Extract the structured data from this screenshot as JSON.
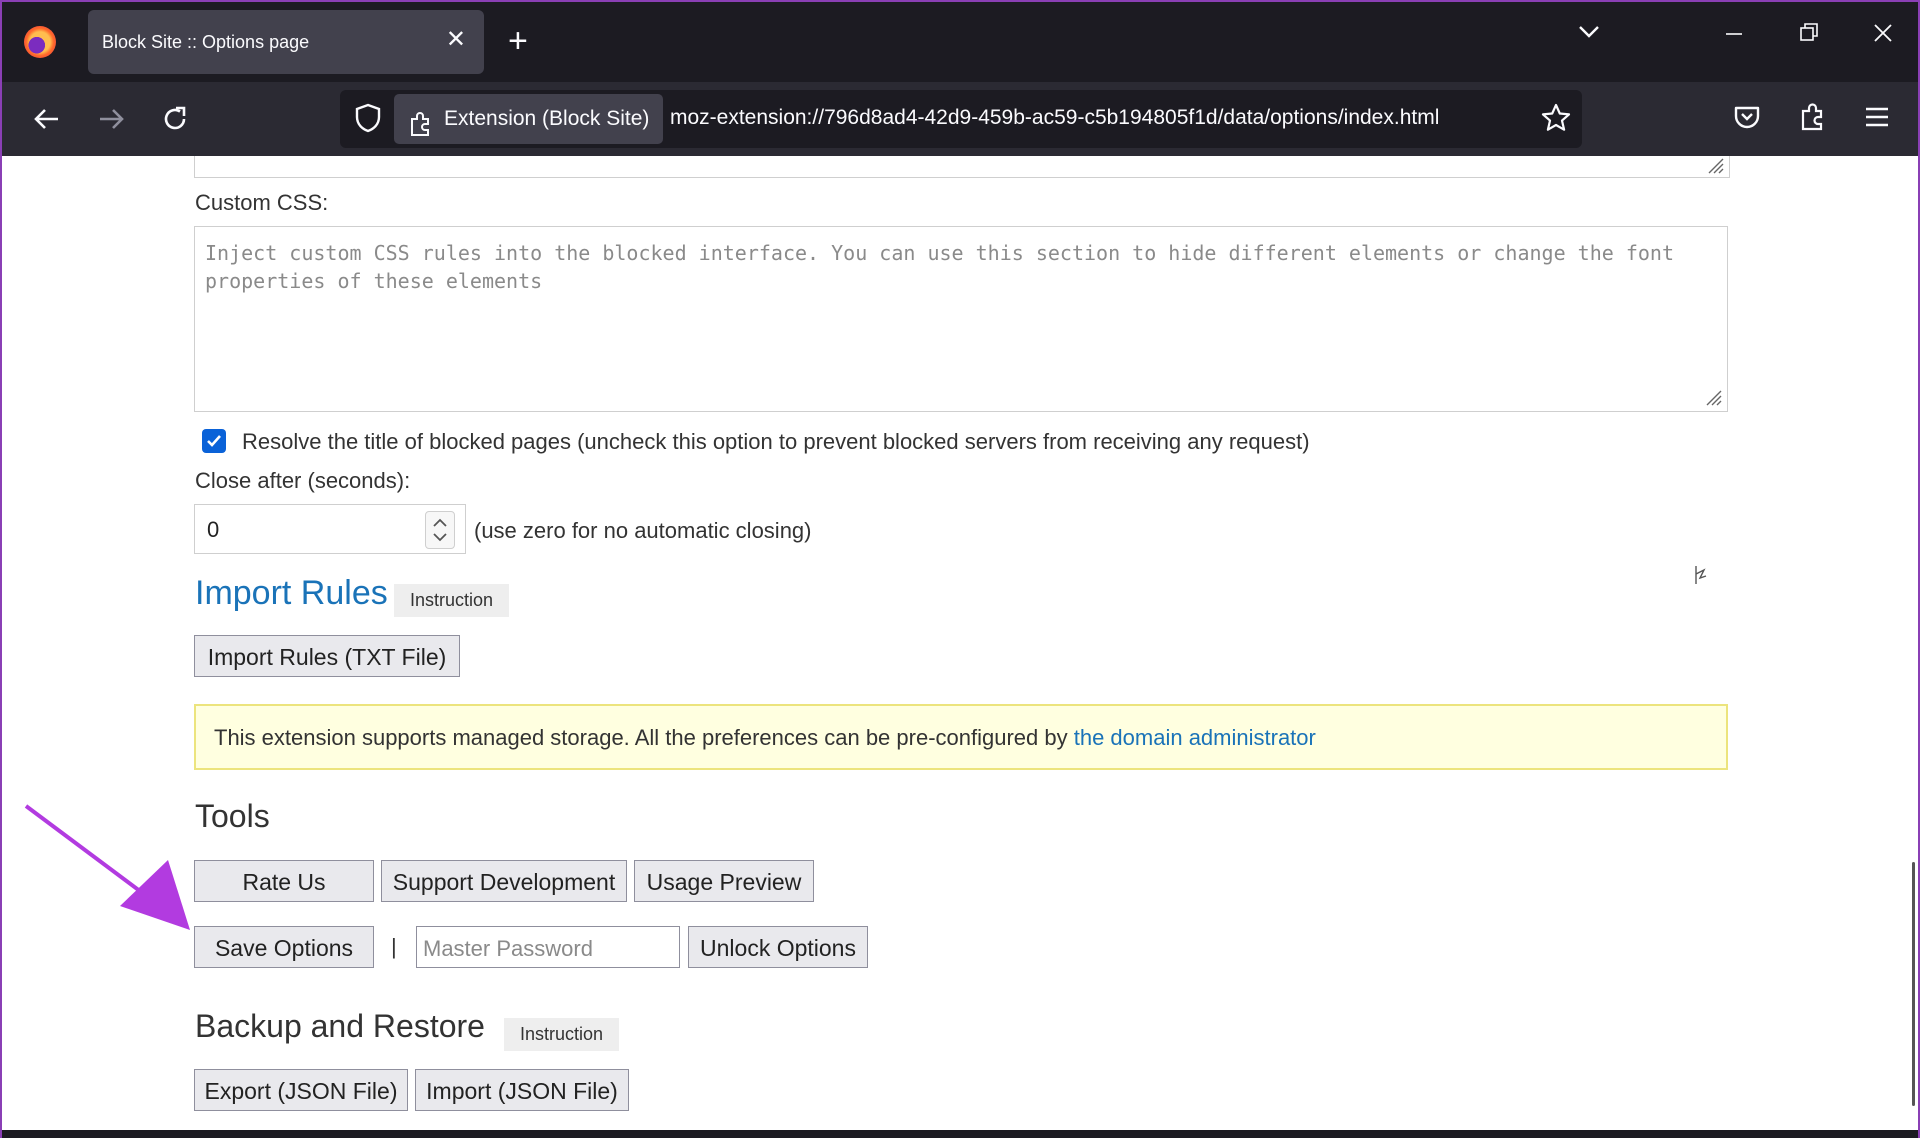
{
  "browser": {
    "tab_title": "Block Site :: Options page",
    "tab_close": "✕",
    "new_tab": "+",
    "window_controls": {
      "minimize": "—",
      "restore": "❐",
      "close": "✕",
      "tab_list": "⌄"
    },
    "url_chip": "Extension (Block Site)",
    "url": "moz-extension://796d8ad4-42d9-459b-ac59-c5b194805f1d/data/options/index.html",
    "icons": [
      "firefox-logo-icon",
      "back-arrow-icon",
      "forward-arrow-icon",
      "reload-icon",
      "shield-icon",
      "puzzle-icon",
      "star-icon",
      "pocket-icon",
      "extensions-icon",
      "menu-icon"
    ]
  },
  "page": {
    "custom_css_label": "Custom CSS:",
    "custom_css_placeholder": "Inject custom CSS rules into the blocked interface. You can use this section to hide different elements or change the font properties of these elements",
    "resolve_title_label": "Resolve the title of blocked pages (uncheck this option to prevent blocked servers from receiving any request)",
    "resolve_title_checked": true,
    "close_after_label": "Close after (seconds):",
    "close_after_value": "0",
    "close_after_hint": "(use zero for no automatic closing)",
    "import_rules": {
      "heading": "Import Rules",
      "badge": "Instruction",
      "button": "Import Rules (TXT File)"
    },
    "notice": {
      "text": "This extension supports managed storage. All the preferences can be pre-configured by ",
      "link": "the domain administrator"
    },
    "tools": {
      "heading": "Tools",
      "rate_us": "Rate Us",
      "support": "Support Development",
      "usage_preview": "Usage Preview",
      "save_options": "Save Options",
      "separator": "|",
      "master_password_placeholder": "Master Password",
      "unlock_options": "Unlock Options"
    },
    "backup": {
      "heading": "Backup and Restore",
      "badge": "Instruction",
      "export": "Export (JSON File)",
      "import": "Import (JSON File)"
    },
    "annotation_arrow_color": "#b23be0",
    "checkbox_color": "#0a62d8",
    "link_color": "#1a73b8"
  }
}
